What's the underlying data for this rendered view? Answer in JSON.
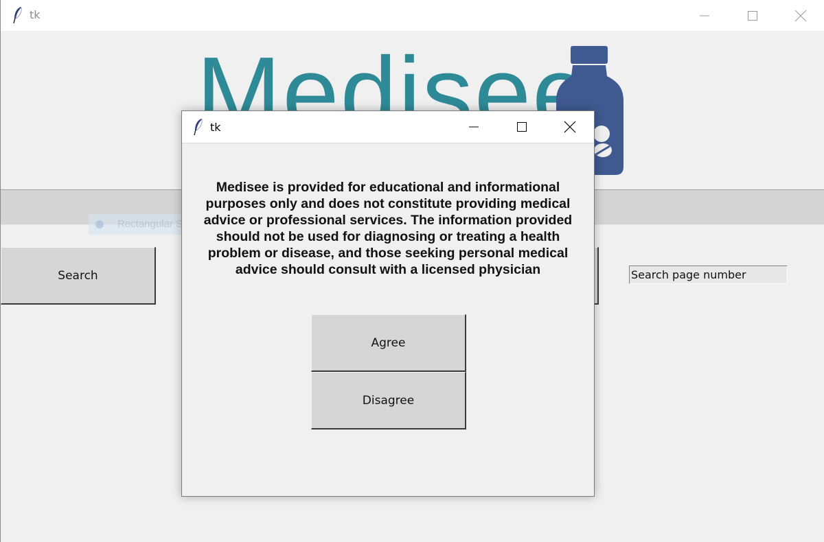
{
  "main_window": {
    "title": "tk",
    "logo_text": "Medisee",
    "search_button_label": "Search",
    "page_entry_value": "Search page number",
    "snip_ghost_label": "Rectangular Snip"
  },
  "dialog": {
    "title": "tk",
    "disclaimer": "Medisee is provided for educational and informational purposes only and does not constitute providing medical advice or professional services. The information provided should not be used for diagnosing or treating a health problem or disease, and those seeking personal medical advice should consult with a licensed physician",
    "agree_label": "Agree",
    "disagree_label": "Disagree"
  },
  "colors": {
    "logo_teal": "#2f8a98",
    "logo_bottle_blue": "#3f5a91",
    "button_face": "#d6d6d6",
    "window_bg": "#f0f0f0"
  },
  "icons": [
    "feather-icon",
    "minimize-icon",
    "maximize-icon",
    "close-icon",
    "medicine-bottle-icon"
  ]
}
